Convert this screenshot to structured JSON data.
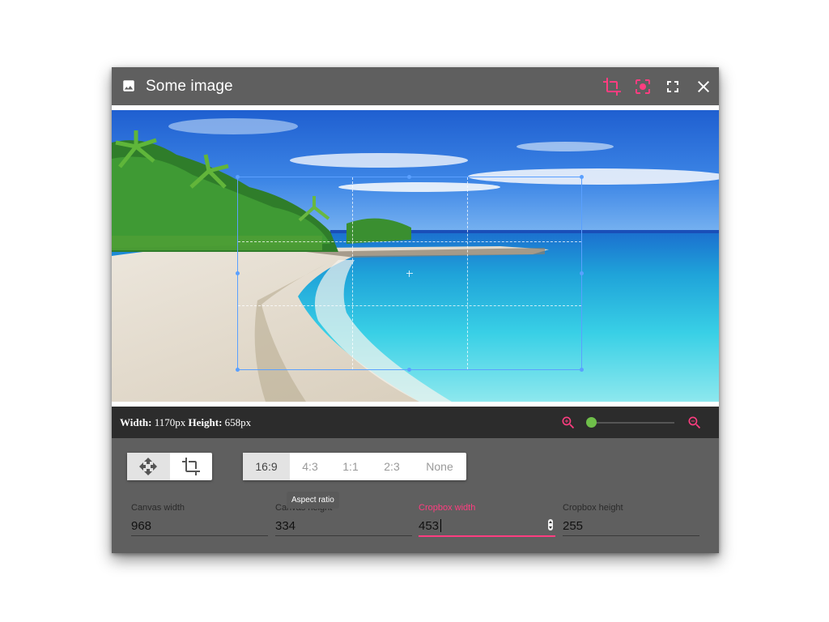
{
  "dialog": {
    "title": "Some image",
    "icons": {
      "image": "image-icon",
      "crop": "crop-icon",
      "focus": "focus-icon",
      "fullscreen": "fullscreen-icon",
      "close": "close-icon"
    },
    "accent_color": "#ff3d80"
  },
  "info": {
    "width_label": "Width:",
    "width_value": "1170px",
    "height_label": "Height:",
    "height_value": "658px",
    "zoom_in_icon": "zoom-in-icon",
    "zoom_out_icon": "zoom-out-icon",
    "slider_color": "#6fbf4a"
  },
  "modes": [
    {
      "icon": "move-icon",
      "active": true
    },
    {
      "icon": "crop-icon",
      "active": false
    }
  ],
  "ratios": [
    "16:9",
    "4:3",
    "1:1",
    "2:3",
    "None"
  ],
  "tooltip": "Aspect ratio",
  "fields": {
    "canvas_width": {
      "label": "Canvas width",
      "value": "968"
    },
    "canvas_height": {
      "label": "Canvas height",
      "value": "334"
    },
    "cropbox_width": {
      "label": "Cropbox width",
      "value": "453"
    },
    "cropbox_height": {
      "label": "Cropbox height",
      "value": "255"
    }
  }
}
